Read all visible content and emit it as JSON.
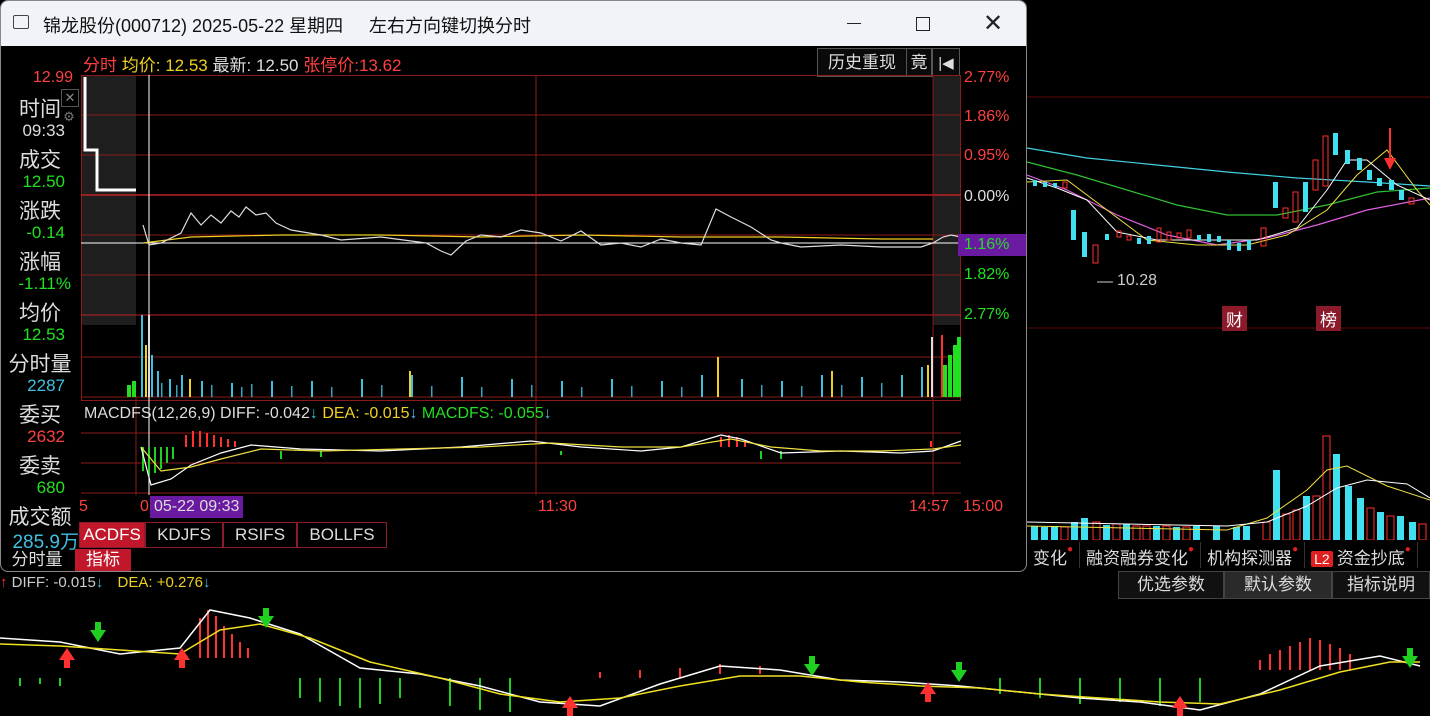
{
  "background": {
    "low_price_label": "10.28",
    "badges": [
      "财",
      "榜"
    ],
    "tabs": [
      "变化",
      "融资融券变化",
      "机构探测器",
      "资金抄底"
    ],
    "l2_badge": "L2",
    "params": {
      "optimize": "优选参数",
      "default": "默认参数",
      "help": "指标说明"
    },
    "diff_line": {
      "diff_label": "DIFF: -0.015",
      "dea_label": "DEA: +0.276"
    }
  },
  "dialog": {
    "title": "锦龙股份(000712) 2025-05-22 星期四",
    "hint": "左右方向键切换分时",
    "header": {
      "mode": "分时",
      "avg_label": "均价:",
      "avg_value": "12.53",
      "latest_label": "最新:",
      "latest_value": "12.50",
      "limit_label": "张停价:",
      "limit_value": "13.62",
      "history_button": "历史重现",
      "auction_button": "竟"
    },
    "price_axis": {
      "top_price": "12.99",
      "right_pcts_upper": [
        "2.77%",
        "1.86%",
        "0.95%",
        "0.00%"
      ],
      "current_pct": "1.16%",
      "right_pcts_lower": [
        "1.82%",
        "2.77%"
      ]
    },
    "info_panel": {
      "time_label": "时间",
      "time_value": "09:33",
      "deal_label": "成交",
      "deal_value": "12.50",
      "change_label": "涨跌",
      "change_value": "-0.14",
      "change_pct_label": "涨幅",
      "change_pct_value": "-1.11%",
      "avg_label": "均价",
      "avg_value": "12.53",
      "volume_label": "分时量",
      "volume_value": "2287",
      "bid_label": "委买",
      "bid_value": "2632",
      "ask_label": "委卖",
      "ask_value": "680",
      "amount_label": "成交额",
      "amount_value": "285.9万"
    },
    "macd": {
      "name": "MACDFS(12,26,9)",
      "diff": "DIFF: -0.042",
      "dea": "DEA: -0.015",
      "macdfs": "MACDFS: -0.055"
    },
    "time_axis": {
      "cursor": "05-22 09:33",
      "left_partial": "5",
      "zero": "0",
      "mid": "11:30",
      "last": "14:57",
      "close": "15:00"
    },
    "indicator_tabs": [
      "ACDFS",
      "KDJFS",
      "RSIFS",
      "BOLLFS"
    ],
    "bottom_tabs": [
      "分时量",
      "指标"
    ],
    "colors": {
      "up": "#ff3030",
      "down": "#20e020",
      "avg": "#f0d020",
      "accent": "#c0182a",
      "purple": "#6a1aa0"
    }
  }
}
